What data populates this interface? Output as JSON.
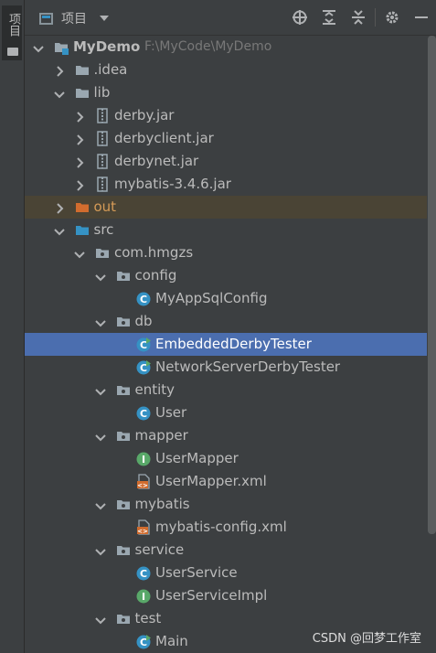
{
  "side_panel": {
    "tab_label": "项目"
  },
  "toolbar": {
    "title": "项目",
    "icons": [
      "locate-icon",
      "expand-all-icon",
      "collapse-all-icon",
      "gear-icon",
      "minimize-icon"
    ]
  },
  "tree": {
    "rows": [
      {
        "label": "MyDemo",
        "path": "F:\\MyCode\\MyDemo",
        "level": 0,
        "arrow": "down",
        "icon": "module-folder-icon",
        "bold": true
      },
      {
        "label": ".idea",
        "level": 1,
        "arrow": "right",
        "icon": "folder-icon"
      },
      {
        "label": "lib",
        "level": 1,
        "arrow": "down",
        "icon": "folder-icon"
      },
      {
        "label": "derby.jar",
        "level": 2,
        "arrow": "right",
        "icon": "jar-icon"
      },
      {
        "label": "derbyclient.jar",
        "level": 2,
        "arrow": "right",
        "icon": "jar-icon"
      },
      {
        "label": "derbynet.jar",
        "level": 2,
        "arrow": "right",
        "icon": "jar-icon"
      },
      {
        "label": "mybatis-3.4.6.jar",
        "level": 2,
        "arrow": "right",
        "icon": "jar-icon"
      },
      {
        "label": "out",
        "level": 1,
        "arrow": "right",
        "icon": "excluded-folder-icon",
        "highlight": true,
        "orange": true
      },
      {
        "label": "src",
        "level": 1,
        "arrow": "down",
        "icon": "source-folder-icon"
      },
      {
        "label": "com.hmgzs",
        "level": 2,
        "arrow": "down",
        "icon": "package-icon"
      },
      {
        "label": "config",
        "level": 3,
        "arrow": "down",
        "icon": "package-icon"
      },
      {
        "label": "MyAppSqlConfig",
        "level": 4,
        "icon": "class-icon"
      },
      {
        "label": "db",
        "level": 3,
        "arrow": "down",
        "icon": "package-icon"
      },
      {
        "label": "EmbeddedDerbyTester",
        "level": 4,
        "icon": "runnable-class-icon",
        "selected": true
      },
      {
        "label": "NetworkServerDerbyTester",
        "level": 4,
        "icon": "runnable-class-icon"
      },
      {
        "label": "entity",
        "level": 3,
        "arrow": "down",
        "icon": "package-icon"
      },
      {
        "label": "User",
        "level": 4,
        "icon": "class-icon"
      },
      {
        "label": "mapper",
        "level": 3,
        "arrow": "down",
        "icon": "package-icon"
      },
      {
        "label": "UserMapper",
        "level": 4,
        "icon": "interface-icon"
      },
      {
        "label": "UserMapper.xml",
        "level": 4,
        "icon": "xml-file-icon"
      },
      {
        "label": "mybatis",
        "level": 3,
        "arrow": "down",
        "icon": "package-icon"
      },
      {
        "label": "mybatis-config.xml",
        "level": 4,
        "icon": "xml-file-icon"
      },
      {
        "label": "service",
        "level": 3,
        "arrow": "down",
        "icon": "package-icon"
      },
      {
        "label": "UserService",
        "level": 4,
        "icon": "class-icon"
      },
      {
        "label": "UserServiceImpl",
        "level": 4,
        "icon": "interface-icon"
      },
      {
        "label": "test",
        "level": 3,
        "arrow": "down",
        "icon": "package-icon"
      },
      {
        "label": "Main",
        "level": 4,
        "icon": "runnable-class-icon"
      }
    ]
  },
  "watermark": "CSDN @回梦工作室",
  "colors": {
    "background": "#3c3f41",
    "selection": "#4b6eaf",
    "excluded_highlight": "#4a4435",
    "class_icon": "#3592c4",
    "interface_icon": "#59a869",
    "excluded_folder": "#d16c2e"
  }
}
